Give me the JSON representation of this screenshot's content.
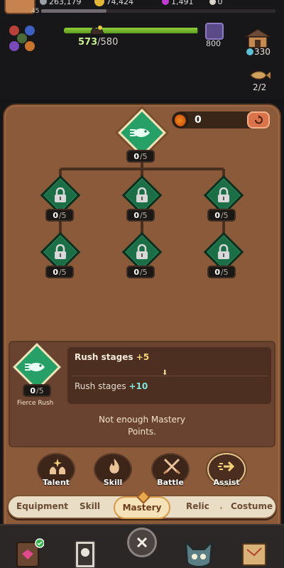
{
  "hud": {
    "level": "45",
    "gold": "263,179",
    "coins": "74,424",
    "gems": "1,491",
    "fourth": "0",
    "stamina_current": "573",
    "stamina_max": "/580",
    "chest_count": "800",
    "shop_count": "330",
    "fish_count": "2/2"
  },
  "mastery": {
    "points": "0",
    "nodes": [
      {
        "id": "root",
        "current": "0",
        "total": "/5"
      },
      {
        "id": "r1c1",
        "current": "0",
        "total": "/5"
      },
      {
        "id": "r1c2",
        "current": "0",
        "total": "/5"
      },
      {
        "id": "r1c3",
        "current": "0",
        "total": "/5"
      },
      {
        "id": "r2c1",
        "current": "0",
        "total": "/5"
      },
      {
        "id": "r2c2",
        "current": "0",
        "total": "/5"
      },
      {
        "id": "r2c3",
        "current": "0",
        "total": "/5"
      }
    ]
  },
  "info": {
    "skill_name": "Fierce Rush",
    "skill_current": "0",
    "skill_total": "/5",
    "line1_label": "Rush stages ",
    "line1_value": "+5",
    "line2_label": "Rush stages ",
    "line2_value": "+10",
    "notice": "Not enough Mastery Points."
  },
  "subtabs": [
    {
      "label": "Talent",
      "icon": "hands-sparkle-icon"
    },
    {
      "label": "Skill",
      "icon": "flame-icon"
    },
    {
      "label": "Battle",
      "icon": "crossed-swords-icon"
    },
    {
      "label": "Assist",
      "icon": "dash-arrow-icon"
    }
  ],
  "tabs": [
    "Equipment",
    "Skill",
    "Mastery",
    "Relic",
    "Costume"
  ],
  "active_tab": "Mastery",
  "colors": {
    "panel": "#8a5a3a",
    "node_locked": "#1c6e46",
    "node_active": "#26a067",
    "accent": "#f5d27a"
  }
}
